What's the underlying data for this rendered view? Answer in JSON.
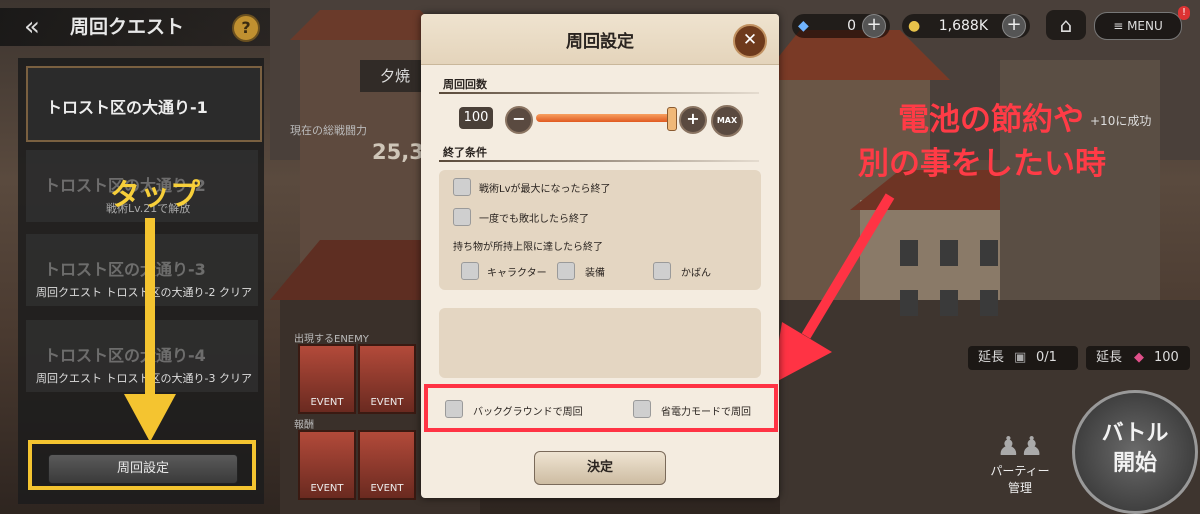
{
  "header": {
    "back_icon": "double-chevron-left-icon",
    "title": "周回クエスト",
    "help_label": "?",
    "resource_1": {
      "icon": "ticket-icon",
      "value": "0"
    },
    "resource_2": {
      "icon": "coin-icon",
      "value": "1,688K"
    },
    "plus_label": "+",
    "home_icon": "home-icon",
    "menu_label": "≡ MENU",
    "menu_badge": "!"
  },
  "stages": [
    {
      "name": "トロスト区の大通り-1",
      "sub": ""
    },
    {
      "name": "トロスト区の大通り-2",
      "sub": "戦術Lv.21で解放"
    },
    {
      "name": "トロスト区の大通り-3",
      "sub": "周回クエスト トロスト区の大通り-2 クリア"
    },
    {
      "name": "トロスト区の大通り-4",
      "sub": "周回クエスト トロスト区の大通り-3 クリア"
    }
  ],
  "left_panel": {
    "loop_setting_button": "周回設定"
  },
  "annotations": {
    "tap": "タップ",
    "note_line1": "電池の節約や",
    "note_line2": "別の事をしたい時",
    "tap_color": "#f4c430",
    "note_color": "#ff3344"
  },
  "scene": {
    "tab_label": "夕焼",
    "power_label": "現在の総戦闘力",
    "power_value": "25,3",
    "reward_label": "出現するENEMY",
    "reward_label2": "報酬",
    "card_label": "EVENT",
    "right_note": "+10に成功",
    "extend_label": "延長",
    "extend_1_value": "0/1",
    "extend_2_value": "100",
    "battle_line1": "バトル",
    "battle_line2": "開始",
    "party_line1": "パーティー",
    "party_line2": "管理"
  },
  "modal": {
    "title": "周回設定",
    "close_icon": "close-icon",
    "loop_count_label": "周回回数",
    "loop_count_value": "100",
    "minus_label": "−",
    "plus_label": "+",
    "max_label": "MAX",
    "slider_fill": 1.0,
    "end_conditions_label": "終了条件",
    "conditions": [
      {
        "label": "戦術Lvが最大になったら終了",
        "checked": false
      },
      {
        "label": "一度でも敗北したら終了",
        "checked": false
      }
    ],
    "inventory_label": "持ち物が所持上限に達したら終了",
    "inventory_options": [
      {
        "label": "キャラクター",
        "checked": false
      },
      {
        "label": "装備",
        "checked": false
      },
      {
        "label": "かばん",
        "checked": false
      }
    ],
    "background_loop_label": "バックグラウンドで周回",
    "power_saving_label": "省電力モードで周回",
    "confirm_label": "決定"
  }
}
